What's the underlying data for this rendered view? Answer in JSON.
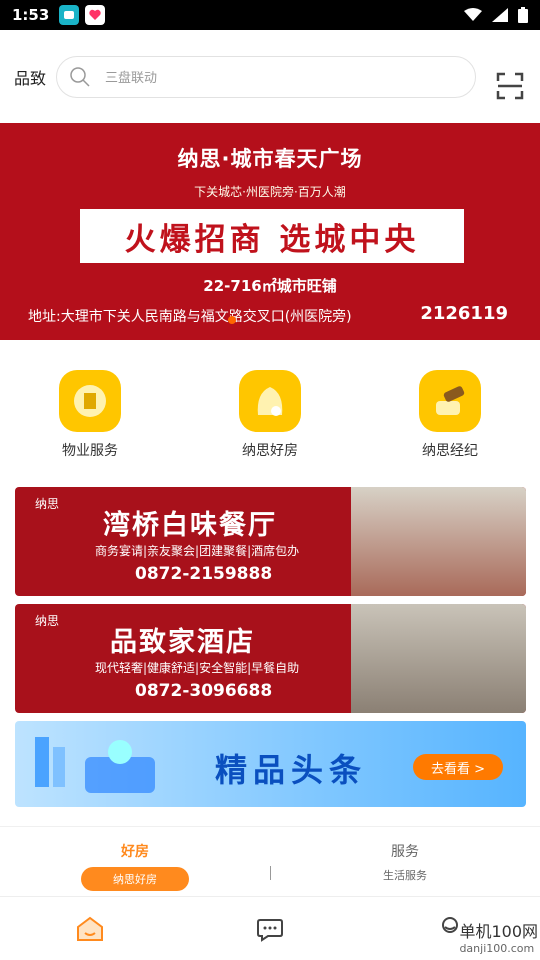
{
  "status": {
    "time": "1:53"
  },
  "header": {
    "brand": "品致",
    "search_placeholder": "三盘联动"
  },
  "banner": {
    "title": "纳思·城市春天广场",
    "subtitle": "下关城芯·州医院旁·百万人潮",
    "headline": "火爆招商 选城中央",
    "area": "22-716㎡城市旺铺",
    "address": "地址:大理市下关人民南路与福文路交叉口(州医院旁)",
    "phone": "2126119"
  },
  "services": [
    {
      "label": "物业服务",
      "icon": "property-icon"
    },
    {
      "label": "纳思好房",
      "icon": "house-icon"
    },
    {
      "label": "纳思经纪",
      "icon": "broker-icon"
    }
  ],
  "promos": {
    "restaurant": {
      "logo": "纳思",
      "title": "湾桥白味餐厅",
      "subtitle": "商务宴请|亲友聚会|团建聚餐|酒席包办",
      "phone": "0872-2159888"
    },
    "hotel": {
      "logo": "纳思",
      "title": "品致家酒店",
      "subtitle": "现代轻奢|健康舒适|安全智能|早餐自助",
      "phone": "0872-3096688"
    },
    "headlines": {
      "title": "精品头条",
      "button": "去看看 >"
    }
  },
  "tabs": [
    {
      "main": "好房",
      "sub": "纳思好房",
      "active": true
    },
    {
      "main": "服务",
      "sub": "生活服务",
      "active": false
    }
  ],
  "watermark": {
    "line1": "单机100网",
    "line2": "danji100.com"
  },
  "colors": {
    "accent": "#ff8a1e",
    "banner_red": "#b40f1b",
    "blue": "#0a4fbf"
  }
}
